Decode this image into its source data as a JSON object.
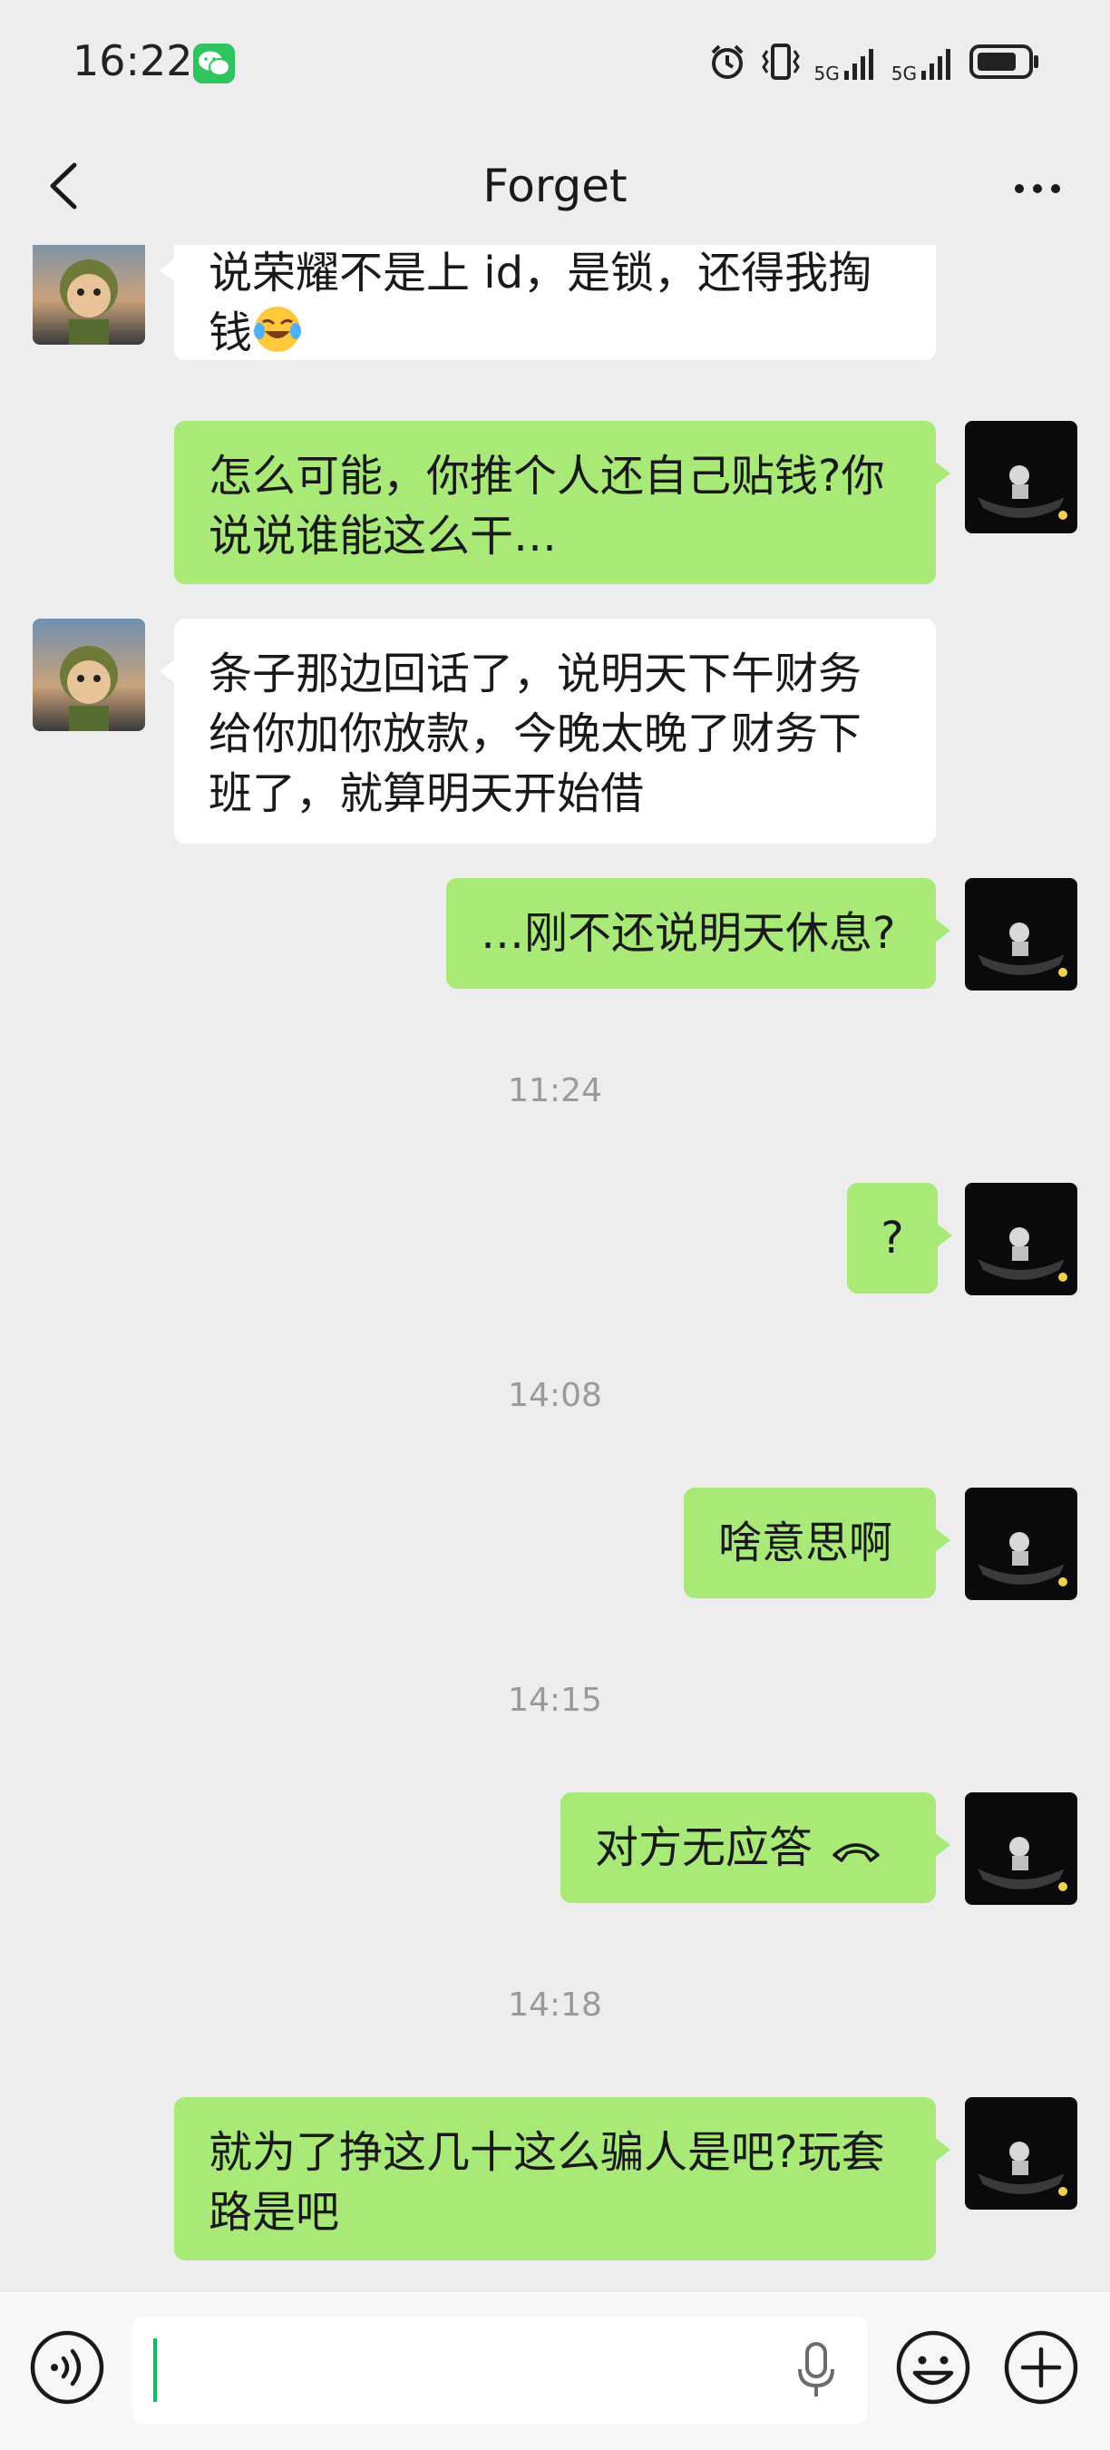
{
  "status_bar": {
    "time": "16:22",
    "network_1": "5G",
    "network_2": "5G"
  },
  "header": {
    "title": "Forget"
  },
  "messages": [
    {
      "side": "in",
      "text": "说荣耀不是上 id，是锁，还得我掏钱",
      "emoji": "rolling-on-floor-laughing"
    },
    {
      "side": "out",
      "text": "怎么可能，你推个人还自己贴钱?你说说谁能这么干…"
    },
    {
      "side": "in",
      "text": "条子那边回话了，说明天下午财务给你加你放款，今晚太晚了财务下班了，就算明天开始借"
    },
    {
      "side": "out",
      "text": "…刚不还说明天休息?"
    },
    {
      "type": "time",
      "text": "11:24"
    },
    {
      "side": "out",
      "text": "?"
    },
    {
      "type": "time",
      "text": "14:08"
    },
    {
      "side": "out",
      "text": "啥意思啊"
    },
    {
      "type": "time",
      "text": "14:15"
    },
    {
      "side": "out",
      "text": "对方无应答",
      "icon": "hangup-icon"
    },
    {
      "type": "time",
      "text": "14:18"
    },
    {
      "side": "out",
      "text": "就为了挣这几十这么骗人是吧?玩套路是吧"
    }
  ],
  "input": {
    "value": "",
    "placeholder": ""
  },
  "colors": {
    "background": "#ededed",
    "outgoing_bubble": "#a8e978",
    "incoming_bubble": "#ffffff",
    "accent": "#07c160"
  }
}
